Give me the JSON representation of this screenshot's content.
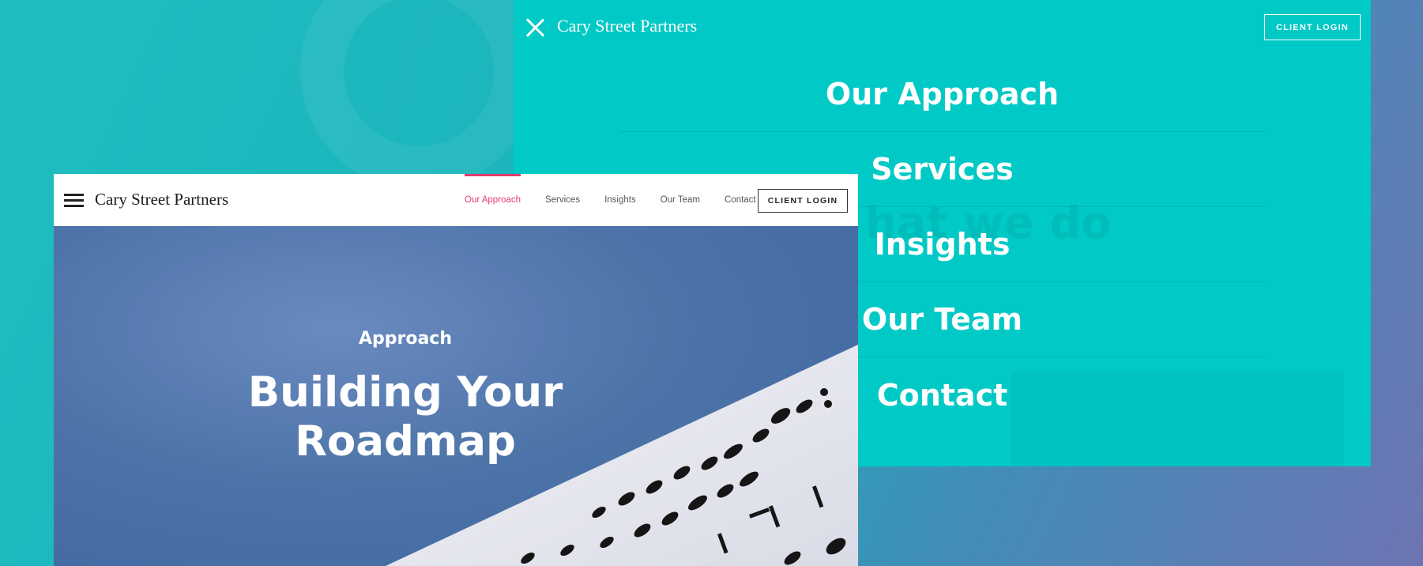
{
  "brand": "Cary Street Partners",
  "client_login": "CLIENT LOGIN",
  "menu_overlay": {
    "items": [
      "Our Approach",
      "Services",
      "Insights",
      "Our Team",
      "Contact"
    ],
    "background_color": "#00c9c6"
  },
  "site": {
    "nav": [
      {
        "label": "Our Approach",
        "active": true
      },
      {
        "label": "Services",
        "active": false
      },
      {
        "label": "Insights",
        "active": false
      },
      {
        "label": "Our Team",
        "active": false
      },
      {
        "label": "Contact",
        "active": false
      }
    ],
    "accent_color": "#e23b6c",
    "hero": {
      "eyebrow": "Approach",
      "title_line1": "Building Your",
      "title_line2": "Roadmap"
    }
  },
  "icons": {
    "menu": "hamburger-icon",
    "close": "close-icon"
  }
}
